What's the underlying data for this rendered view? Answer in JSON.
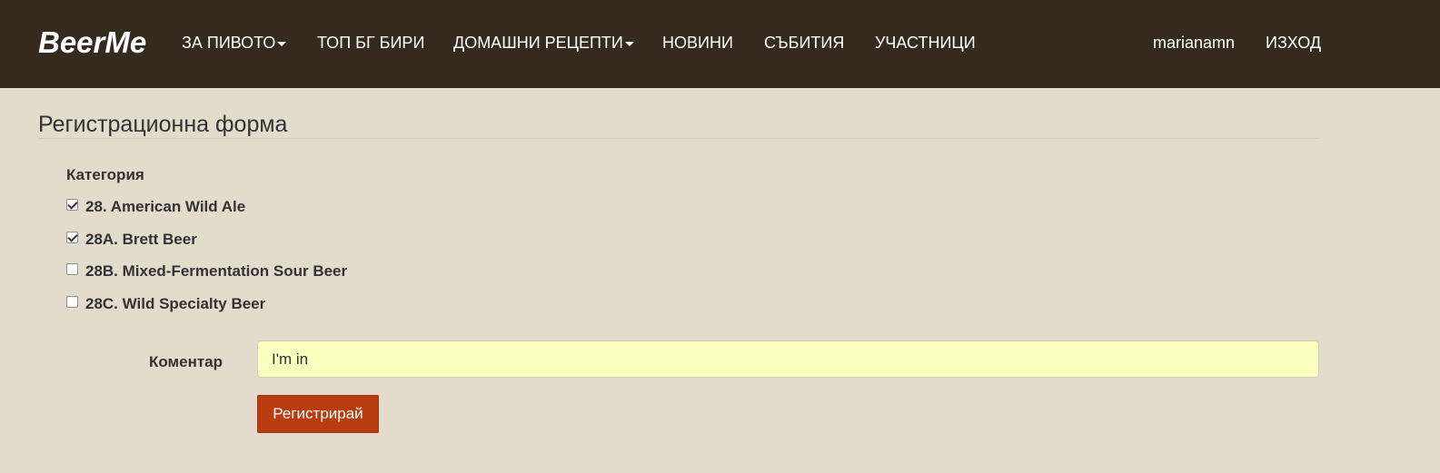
{
  "navbar": {
    "brand": "BeerMe",
    "items": [
      {
        "label": "ЗА ПИВОТО",
        "dropdown": true
      },
      {
        "label": "ТОП БГ БИРИ",
        "dropdown": false
      },
      {
        "label": "ДОМАШНИ РЕЦЕПТИ",
        "dropdown": true
      },
      {
        "label": "НОВИНИ",
        "dropdown": false
      },
      {
        "label": "СЪБИТИЯ",
        "dropdown": false
      },
      {
        "label": "УЧАСТНИЦИ",
        "dropdown": false
      }
    ],
    "user": "marianamn",
    "logout": "ИЗХОД"
  },
  "form": {
    "title": "Регистрационна форма",
    "category_label": "Категория",
    "categories": [
      {
        "label": "28. American Wild Ale",
        "checked": true
      },
      {
        "label": "28A. Brett Beer",
        "checked": true
      },
      {
        "label": "28B. Mixed-Fermentation Sour Beer",
        "checked": false
      },
      {
        "label": "28C. Wild Specialty Beer",
        "checked": false
      }
    ],
    "comment_label": "Коментар",
    "comment_value": "I'm in",
    "submit_label": "Регистрирай"
  },
  "colors": {
    "navbar_bg": "#342a1e",
    "page_bg": "#e3dbcb",
    "button_bg": "#b93b10",
    "input_bg": "#faffbd"
  }
}
